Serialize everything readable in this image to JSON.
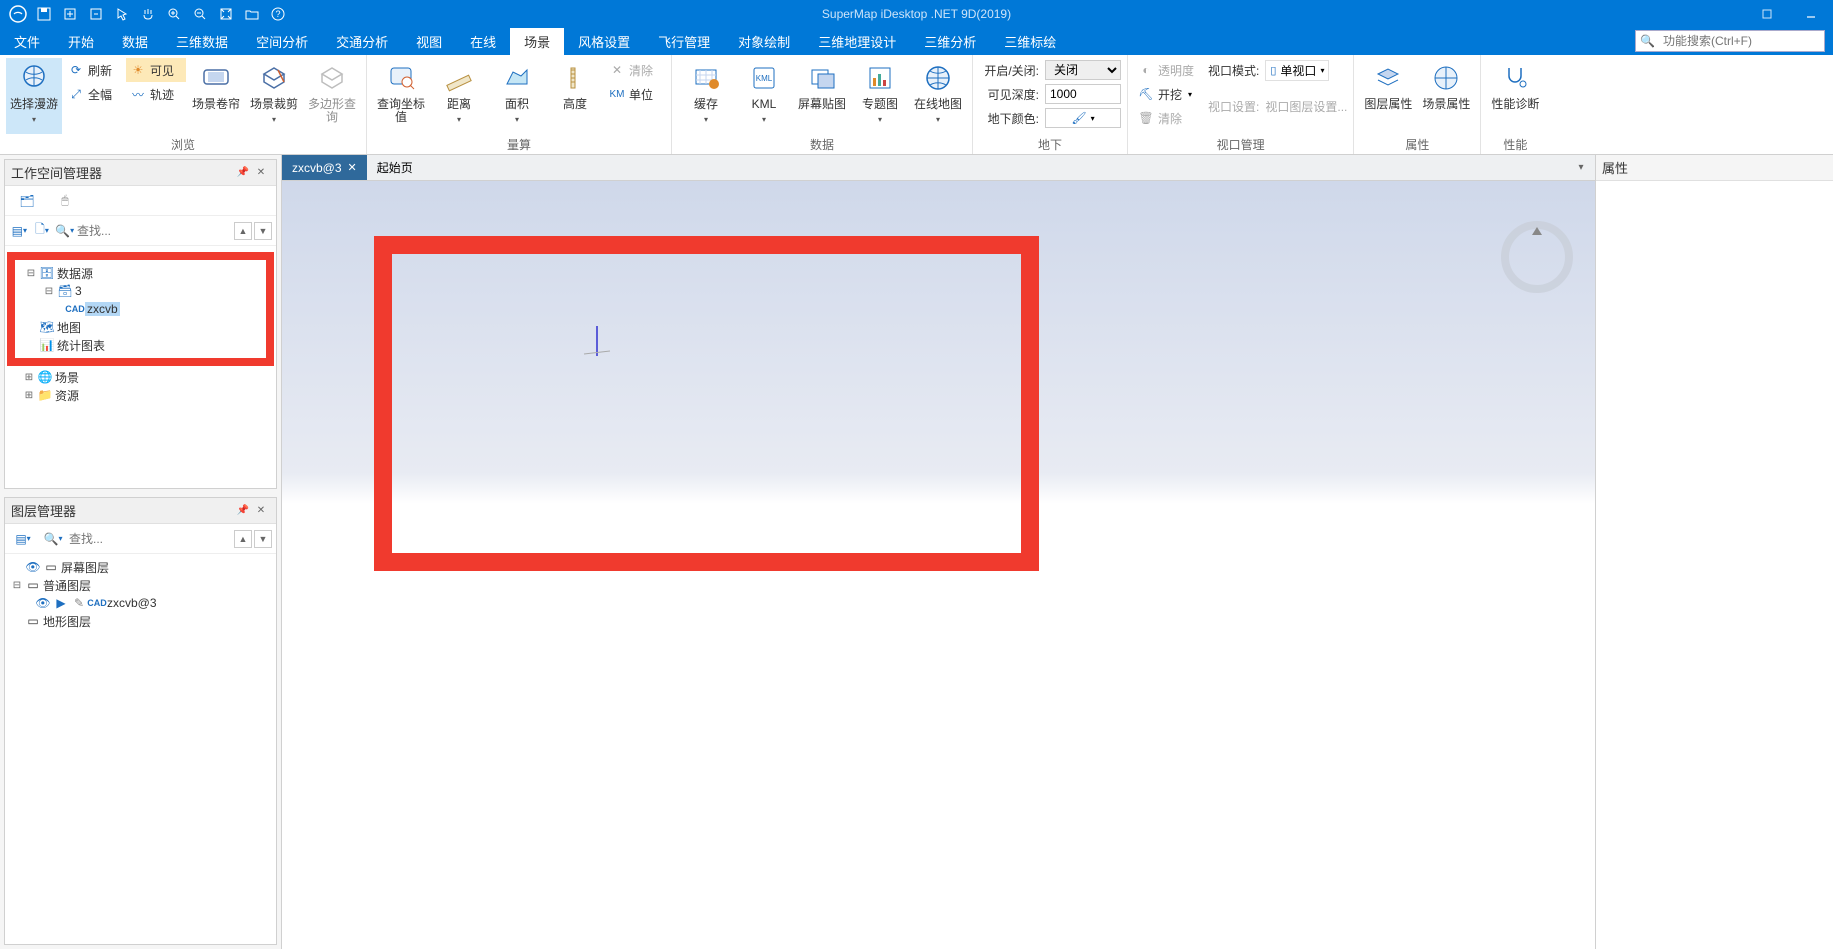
{
  "app": {
    "title": "SuperMap iDesktop .NET 9D(2019)"
  },
  "menu": {
    "tabs": [
      "文件",
      "开始",
      "数据",
      "三维数据",
      "空间分析",
      "交通分析",
      "视图",
      "在线",
      "场景",
      "风格设置",
      "飞行管理",
      "对象绘制",
      "三维地理设计",
      "三维分析",
      "三维标绘"
    ],
    "active_index": 8,
    "search_placeholder": "功能搜索(Ctrl+F)"
  },
  "ribbon": {
    "groups": {
      "browse": {
        "label": "浏览",
        "select_roam": "选择漫游",
        "refresh": "刷新",
        "visible": "可见",
        "full_extent": "全幅",
        "track": "轨迹",
        "scene_roller": "场景卷帘",
        "scene_crop": "场景裁剪",
        "polygon_query": "多边形查询"
      },
      "measure": {
        "label": "量算",
        "query_coord": "查询坐标值",
        "distance": "距离",
        "area": "面积",
        "height": "高度",
        "clear": "清除",
        "unit": "单位"
      },
      "data": {
        "label": "数据",
        "cache": "缓存",
        "kml": "KML",
        "screen_paste": "屏幕贴图",
        "thematic": "专题图",
        "online_map": "在线地图"
      },
      "underground": {
        "label": "地下",
        "open_close": "开启/关闭:",
        "open_close_value": "关闭",
        "visible_depth": "可见深度:",
        "visible_depth_value": "1000",
        "ground_color": "地下颜色:"
      },
      "viewport": {
        "label": "视口管理",
        "transparency": "透明度",
        "excavate": "开挖",
        "clear": "清除",
        "viewport_mode": "视口模式:",
        "viewport_mode_value": "单视口",
        "viewport_setting": "视口设置:",
        "viewport_setting_value": "视口图层设置..."
      },
      "properties": {
        "label": "属性",
        "layer_props": "图层属性",
        "scene_props": "场景属性"
      },
      "performance": {
        "label": "性能",
        "perf_diag": "性能诊断"
      }
    }
  },
  "workspace_panel": {
    "title": "工作空间管理器",
    "search_placeholder": "查找...",
    "tree": {
      "datasource": "数据源",
      "ds_name": "3",
      "dataset": "zxcvb",
      "map": "地图",
      "chart": "统计图表",
      "scene": "场景",
      "resource": "资源"
    }
  },
  "layer_panel": {
    "title": "图层管理器",
    "search_placeholder": "查找...",
    "tree": {
      "screen_layer": "屏幕图层",
      "normal_layer": "普通图层",
      "layer_item": "zxcvb@3",
      "terrain_layer": "地形图层"
    }
  },
  "doc_tabs": {
    "active": "zxcvb@3",
    "start_page": "起始页"
  },
  "right_panel": {
    "title": "属性"
  }
}
